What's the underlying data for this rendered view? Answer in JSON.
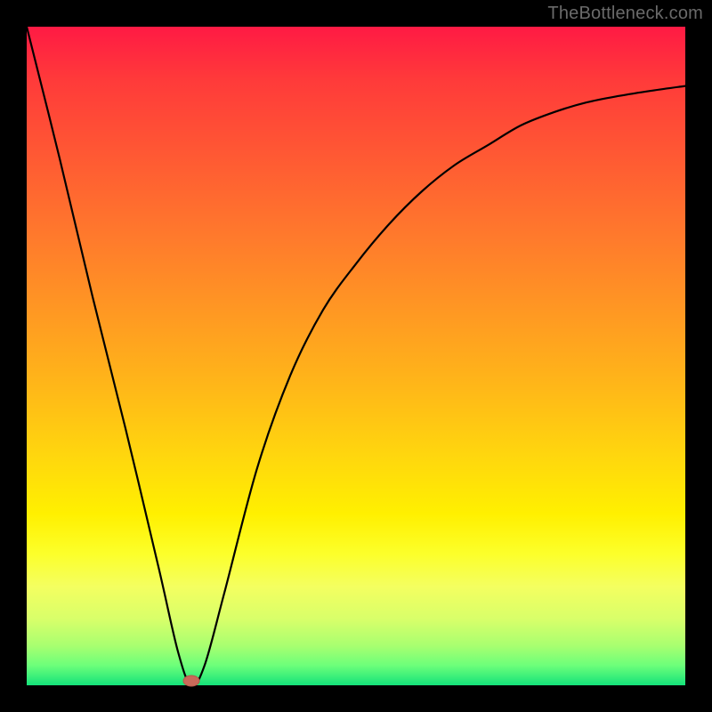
{
  "watermark": "TheBottleneck.com",
  "chart_data": {
    "type": "line",
    "title": "",
    "xlabel": "",
    "ylabel": "",
    "xlim": [
      0,
      100
    ],
    "ylim": [
      0,
      100
    ],
    "grid": false,
    "series": [
      {
        "name": "bottleneck-curve",
        "x": [
          0,
          5,
          10,
          15,
          20,
          23,
          25,
          27,
          30,
          35,
          40,
          45,
          50,
          55,
          60,
          65,
          70,
          75,
          80,
          85,
          90,
          95,
          100
        ],
        "y": [
          100,
          80,
          59,
          39,
          18,
          5,
          0,
          3,
          14,
          33,
          47,
          57,
          64,
          70,
          75,
          79,
          82,
          85,
          87,
          88.5,
          89.5,
          90.3,
          91
        ]
      }
    ],
    "marker": {
      "x": 25,
      "y": 0,
      "name": "bottleneck-point"
    },
    "background_gradient": {
      "orientation": "vertical",
      "stops": [
        {
          "pos": 0.0,
          "color": "#ff1a44"
        },
        {
          "pos": 0.5,
          "color": "#ffb818"
        },
        {
          "pos": 0.8,
          "color": "#fcff2a"
        },
        {
          "pos": 1.0,
          "color": "#14e27a"
        }
      ]
    }
  }
}
